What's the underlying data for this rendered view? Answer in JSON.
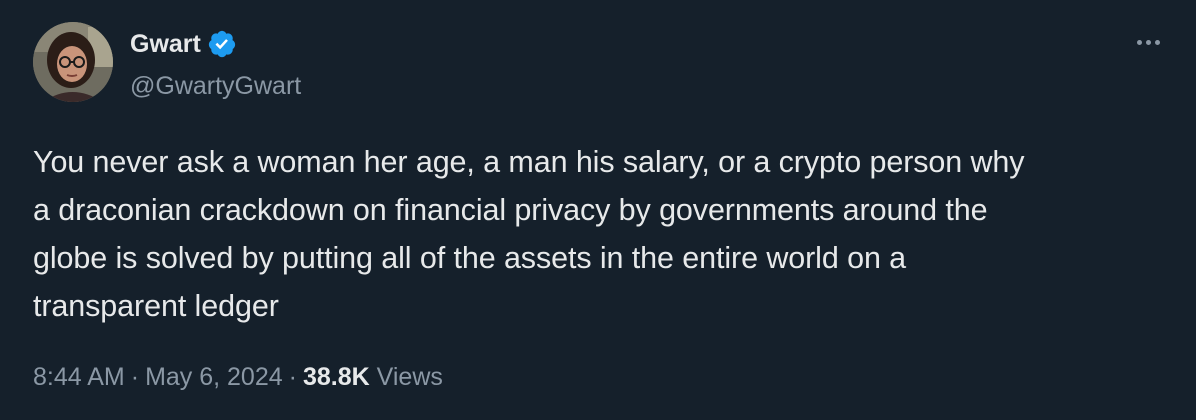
{
  "author": {
    "display_name": "Gwart",
    "handle": "@GwartyGwart",
    "verified": true,
    "avatar_icon": "profile-photo"
  },
  "actions": {
    "more_icon": "more-horizontal-icon"
  },
  "tweet": {
    "lines": [
      "You never ask a woman her age, a man his salary, or a crypto person why",
      "a draconian crackdown on financial privacy by governments around the",
      "globe is solved by putting all of the assets in the entire world on a",
      "transparent ledger"
    ]
  },
  "meta": {
    "time": "8:44 AM",
    "separator": "·",
    "date": "May 6, 2024",
    "views_count": "38.8K",
    "views_label": "Views"
  },
  "colors": {
    "background": "#15202b",
    "text_primary": "#e7e9ea",
    "text_secondary": "#8b98a5",
    "verified_blue": "#1d9bf0"
  }
}
